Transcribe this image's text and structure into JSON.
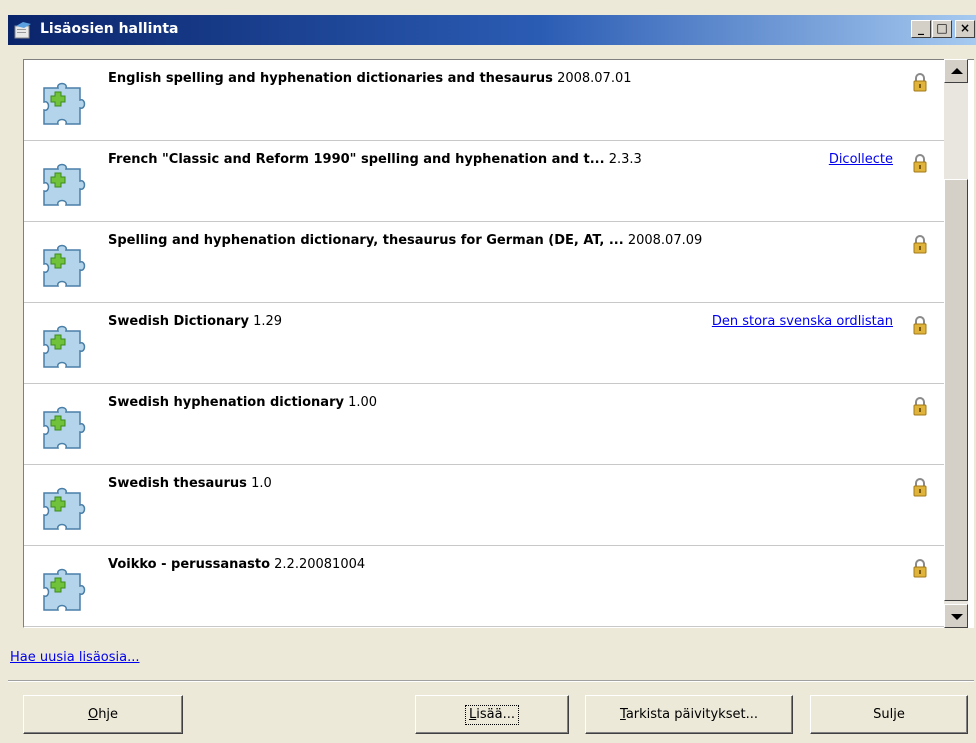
{
  "window": {
    "title": "Lisäosien hallinta"
  },
  "titlebar_buttons": {
    "minimize": "_",
    "maximize": "□",
    "close": "×"
  },
  "extensions": [
    {
      "name": "English spelling and hyphenation dictionaries and thesaurus",
      "version": "2008.07.01",
      "link": "",
      "icon": "puzzle-piece-icon",
      "status_icon": "lock-icon"
    },
    {
      "name": "French \"Classic and Reform 1990\" spelling and hyphenation and t...",
      "version": "2.3.3",
      "link": "Dicollecte",
      "icon": "puzzle-piece-icon",
      "status_icon": "lock-icon"
    },
    {
      "name": "Spelling and hyphenation dictionary, thesaurus for German (DE, AT, ...",
      "version": "2008.07.09",
      "link": "",
      "icon": "puzzle-piece-icon",
      "status_icon": "lock-icon"
    },
    {
      "name": "Swedish Dictionary",
      "version": "1.29",
      "link": "Den stora svenska ordlistan",
      "icon": "puzzle-piece-icon",
      "status_icon": "lock-icon"
    },
    {
      "name": "Swedish hyphenation dictionary",
      "version": "1.00",
      "link": "",
      "icon": "puzzle-piece-icon",
      "status_icon": "lock-icon"
    },
    {
      "name": "Swedish thesaurus",
      "version": "1.0",
      "link": "",
      "icon": "puzzle-piece-icon",
      "status_icon": "lock-icon"
    },
    {
      "name": "Voikko - perussanasto",
      "version": "2.2.20081004",
      "link": "",
      "icon": "puzzle-piece-icon",
      "status_icon": "lock-icon"
    }
  ],
  "more_link": "Hae uusia lisäosia...",
  "buttons": {
    "help": {
      "label": "Ohje",
      "mnemonic": "O",
      "rest": "hje"
    },
    "add": {
      "label": "Lisää...",
      "mnemonic": "L",
      "rest": "isää..."
    },
    "check_updates": {
      "label": "Tarkista päivitykset...",
      "mnemonic": "T",
      "rest": "arkista päivitykset..."
    },
    "close": {
      "label": "Sulje"
    }
  },
  "colors": {
    "title_gradient_start": "#0a246a",
    "title_gradient_end": "#a6caf0",
    "link": "#0000ee",
    "puzzle_blue": "#b3d4ea",
    "plus_green": "#6fc23a",
    "lock_gold": "#e0b43a"
  }
}
